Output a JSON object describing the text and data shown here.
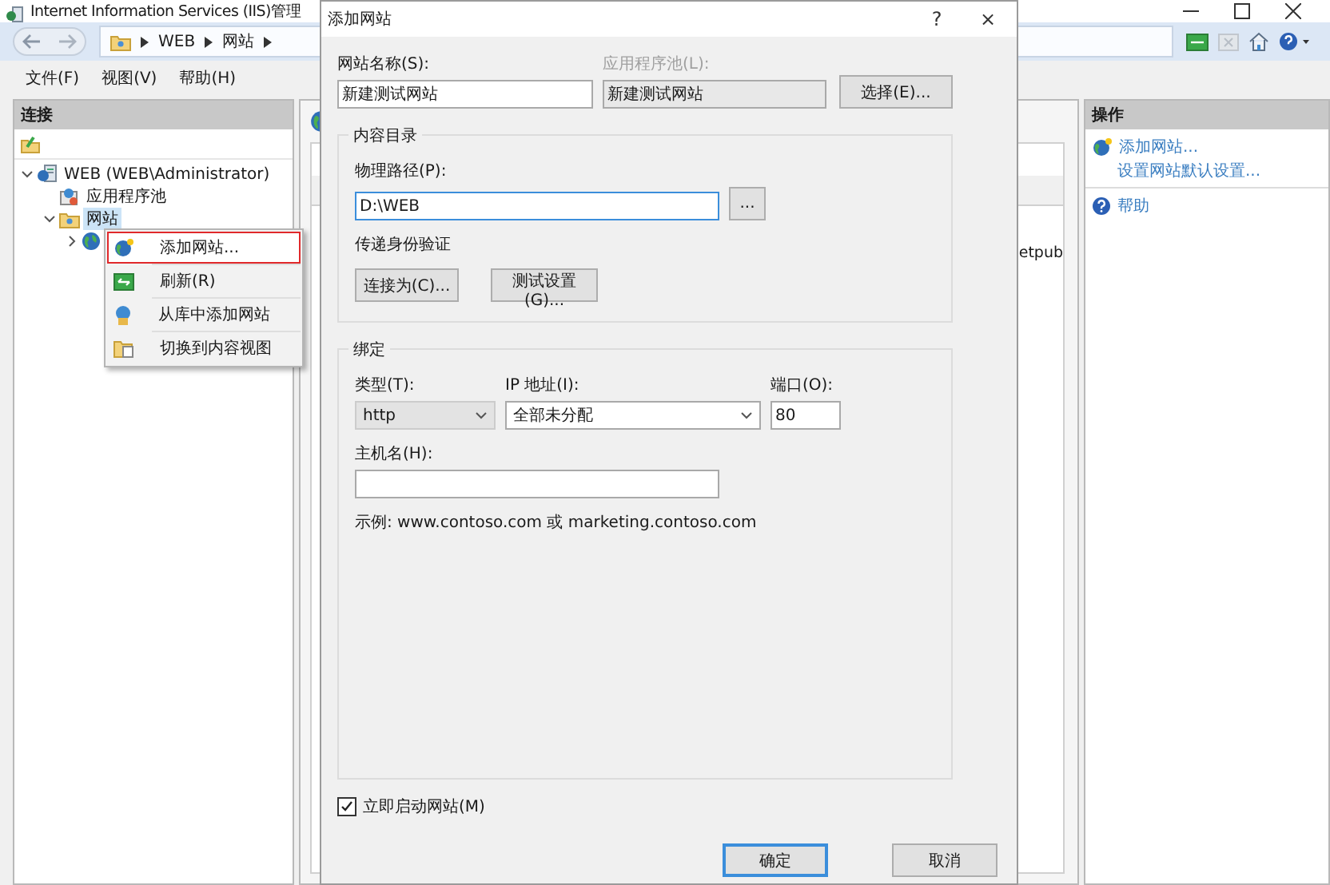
{
  "window": {
    "title": "Internet Information Services (IIS)管理"
  },
  "address_bar": {
    "breadcrumb": [
      "WEB",
      "网站"
    ]
  },
  "menu_bar": [
    "文件(F)",
    "视图(V)",
    "帮助(H)"
  ],
  "connections": {
    "title": "连接",
    "tree": [
      {
        "label": "WEB (WEB\\Administrator)",
        "kind": "server",
        "expanded": true,
        "selected": false,
        "children": [
          {
            "label": "应用程序池",
            "kind": "pool",
            "selected": false
          },
          {
            "label": "网站",
            "kind": "sites",
            "expanded": true,
            "selected": true,
            "children": [
              {
                "kind": "site",
                "expanded": false,
                "selected": false
              }
            ]
          }
        ]
      }
    ]
  },
  "context_menu": [
    {
      "label": "添加网站...",
      "kind": "add-site",
      "selected": true
    },
    {
      "label": "刷新(R)",
      "kind": "refresh",
      "selected": false
    },
    {
      "label": "从库中添加网站",
      "kind": "gallery",
      "selected": false
    },
    {
      "label": "切换到内容视图",
      "kind": "content-view",
      "selected": false
    }
  ],
  "content": {
    "fragment": "etpub"
  },
  "actions": {
    "title": "操作",
    "groups": [
      [
        {
          "label": "添加网站...",
          "kind": "add-site"
        },
        {
          "label": "设置网站默认设置...",
          "kind": "none"
        }
      ],
      [
        {
          "label": "帮助",
          "kind": "help"
        }
      ]
    ]
  },
  "dialog": {
    "title": "添加网站",
    "help_button": "?",
    "close_button": "×",
    "site_name": {
      "label": "网站名称(S):",
      "value": "新建测试网站"
    },
    "app_pool": {
      "label": "应用程序池(L):",
      "value": "新建测试网站",
      "disabled": true
    },
    "select_button": "选择(E)...",
    "content_directory": {
      "title": "内容目录",
      "physical_path": {
        "label": "物理路径(P):",
        "value": "D:\\WEB"
      },
      "browse_button": "...",
      "auth_label": "传递身份验证",
      "connect_button": "连接为(C)...",
      "test_button": "测试设置(G)..."
    },
    "binding": {
      "title": "绑定",
      "type": {
        "label": "类型(T):",
        "value": "http",
        "disabled": true
      },
      "ip": {
        "label": "IP 地址(I):",
        "value": "全部未分配",
        "disabled": false
      },
      "port": {
        "label": "端口(O):",
        "value": "80"
      },
      "host": {
        "label": "主机名(H):"
      },
      "example": "示例: www.contoso.com 或 marketing.contoso.com"
    },
    "start_now": {
      "label": "立即启动网站(M)",
      "checked": true
    },
    "buttons": [
      "确定",
      "取消"
    ]
  }
}
